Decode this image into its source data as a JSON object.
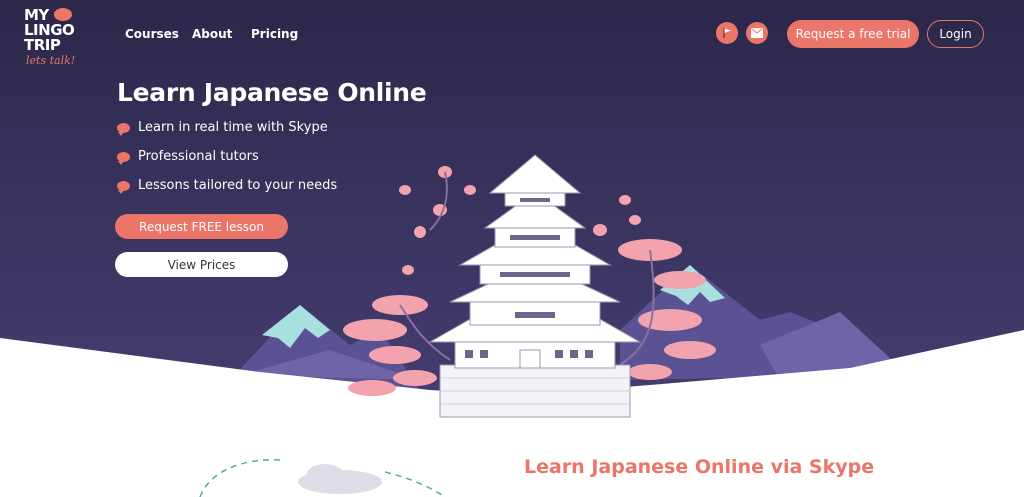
{
  "logo": {
    "line1": "MY",
    "line2": "LINGO",
    "line3": "TRIP",
    "tagline": "lets talk!"
  },
  "nav": {
    "links": [
      "Courses",
      "About",
      "Pricing"
    ],
    "icons": [
      "flag-icon",
      "mail-icon"
    ],
    "trial_label": "Request a free trial",
    "login_label": "Login"
  },
  "hero": {
    "title": "Learn Japanese Online",
    "bullets": [
      "Learn in real time with Skype",
      "Professional tutors",
      "Lessons tailored to your needs"
    ],
    "primary_cta": "Request FREE lesson",
    "secondary_cta": "View Prices"
  },
  "section": {
    "title": "Learn Japanese Online via Skype"
  },
  "colors": {
    "accent": "#ea7568",
    "hero_bg": "#2f2a52",
    "blossom": "#f2a3ad",
    "mountain": "#6f64a8"
  }
}
